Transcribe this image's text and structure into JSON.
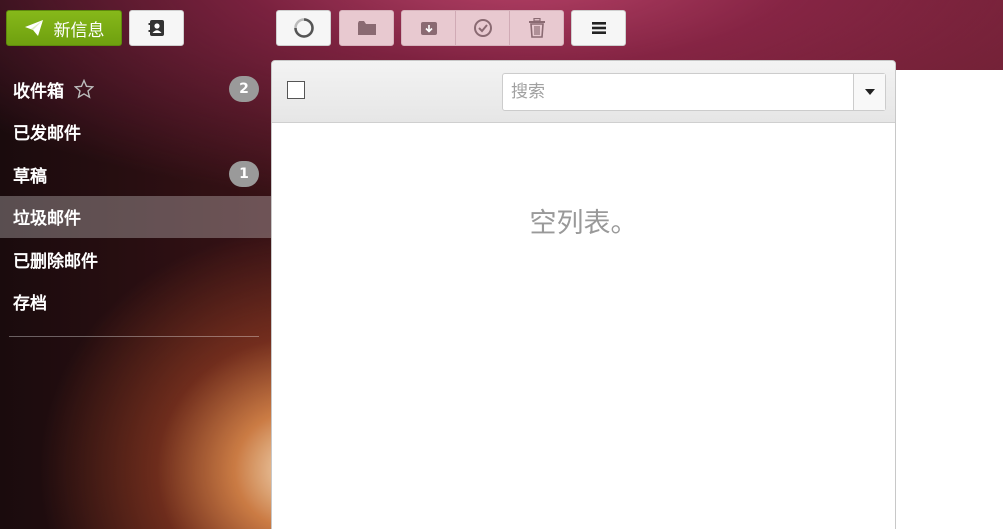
{
  "toolbar": {
    "compose_label": "新信息",
    "icons": [
      "send-icon",
      "contacts-icon",
      "refresh-icon",
      "folder-icon",
      "archive-icon",
      "check-icon",
      "trash-icon",
      "menu-icon"
    ]
  },
  "sidebar": {
    "folders": [
      {
        "label": "收件箱",
        "badge": "2",
        "starred": true
      },
      {
        "label": "已发邮件",
        "badge": ""
      },
      {
        "label": "草稿",
        "badge": "1"
      },
      {
        "label": "垃圾邮件",
        "badge": "",
        "active": true
      },
      {
        "label": "已删除邮件",
        "badge": ""
      },
      {
        "label": "存档",
        "badge": ""
      }
    ]
  },
  "main": {
    "search": {
      "placeholder": "搜索",
      "value": ""
    },
    "empty_text": "空列表。"
  },
  "colors": {
    "compose_green": "#7aae14",
    "badge_gray": "#9a9a9a",
    "active_folder_bg": "rgba(255,255,255,0.28)"
  }
}
